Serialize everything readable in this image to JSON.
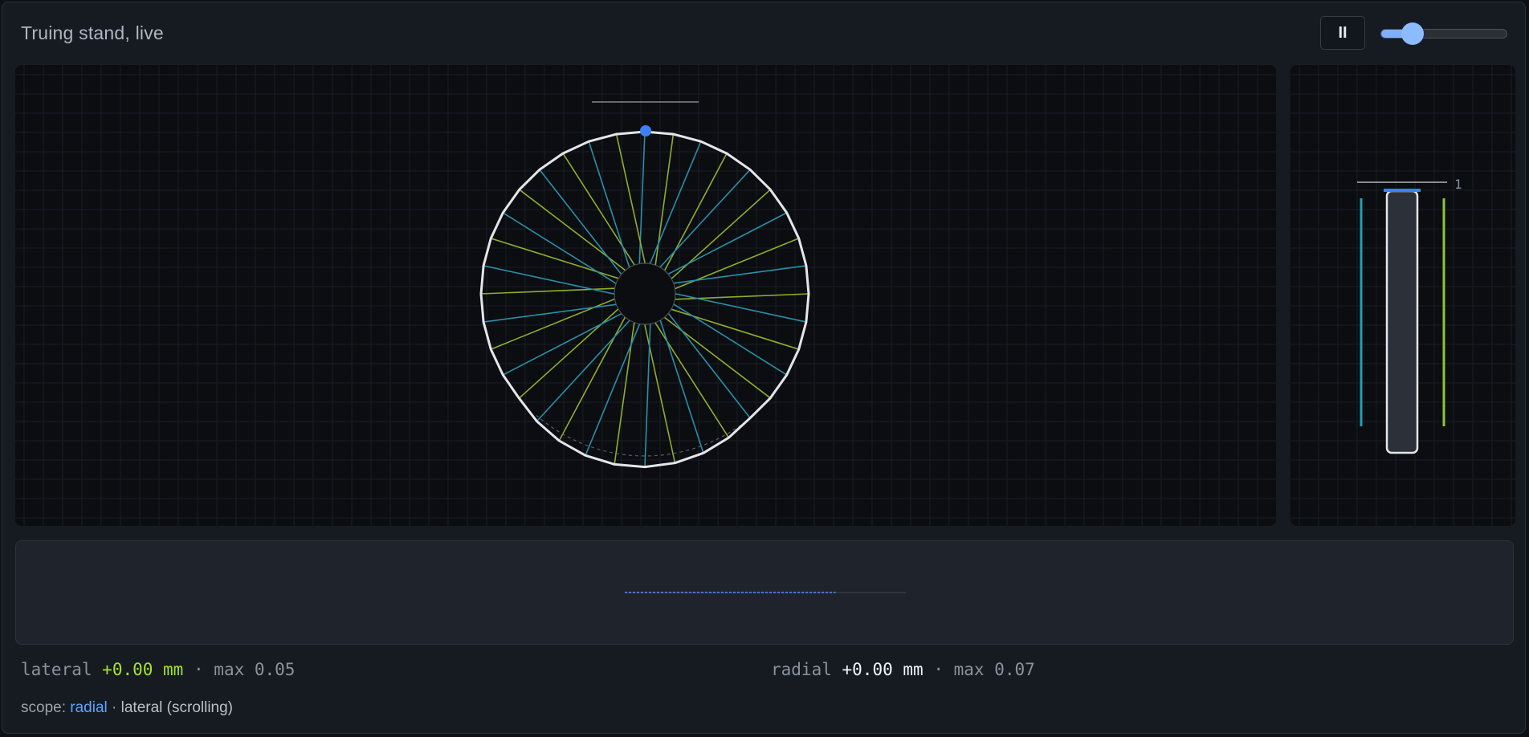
{
  "header": {
    "title": "Truing stand, live",
    "pause_label": "II",
    "speed_slider": {
      "value": 0.25
    }
  },
  "wheel_view": {
    "spoke_count": 36,
    "spoke_colors": [
      "#2a8fa8",
      "#8fae2e"
    ],
    "rim_color": "#e4e6ea",
    "marker_color": "#3b82f6"
  },
  "side_view": {
    "tick_label": "1",
    "left_bar_color": "#1fa0b3",
    "right_bar_color": "#8fc43a",
    "indicator_color": "#3b82f6"
  },
  "scope": {
    "trace_color": "#4f8cff",
    "progress": 0.75
  },
  "readouts": {
    "lateral": {
      "label": "lateral",
      "value": "+0.00 mm",
      "sep": "·",
      "max_label": "max 0.05"
    },
    "radial": {
      "label": "radial",
      "value": "+0.00 mm",
      "sep": "·",
      "max_label": "max 0.07"
    }
  },
  "footer": {
    "prefix": "scope:",
    "active": "radial",
    "sep": "·",
    "rest": "lateral (scrolling)"
  }
}
